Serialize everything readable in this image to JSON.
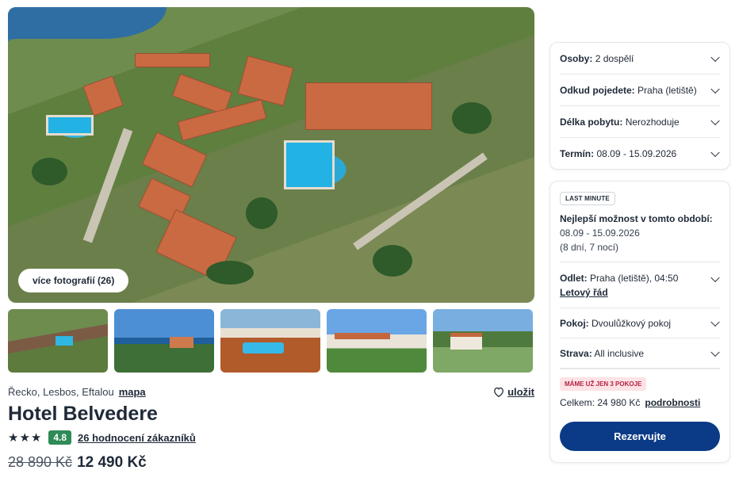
{
  "gallery": {
    "more_photos_label": "více fotografií (26)",
    "thumbnails": [
      "aerial-view",
      "sea-view",
      "pool-terrace",
      "bungalows",
      "garden"
    ]
  },
  "hotel": {
    "location": "Řecko, Lesbos, Eftalou",
    "map_label": "mapa",
    "save_label": "uložit",
    "name": "Hotel Belvedere",
    "stars": "★★★",
    "star_count": 3,
    "score": "4.8",
    "reviews_label": "26 hodnocení zákazníků",
    "old_price": "28 890 Kč",
    "price": "12 490 Kč"
  },
  "search_panel": {
    "persons_label": "Osoby:",
    "persons_value": "2 dospělí",
    "from_label": "Odkud pojedete:",
    "from_value": "Praha (letiště)",
    "length_label": "Délka pobytu:",
    "length_value": "Nerozhoduje",
    "date_label": "Termín:",
    "date_value": "08.09 - 15.09.2026"
  },
  "offer_panel": {
    "badge": "LAST MINUTE",
    "best_heading": "Nejlepší možnost v tomto období:",
    "best_dates": "08.09 - 15.09.2026",
    "best_duration": "(8 dní, 7 nocí)",
    "depart_label": "Odlet:",
    "depart_value": "Praha (letiště), 04:50",
    "schedule_link": "Letový řád",
    "room_label": "Pokoj:",
    "room_value": "Dvoulůžkový pokoj",
    "board_label": "Strava:",
    "board_value": "All inclusive",
    "rooms_badge": "MÁME UŽ JEN 3 POKOJE",
    "total_label": "Celkem: 24 980 Kč",
    "details_link": "podrobnosti",
    "book_button": "Rezervujte"
  },
  "colors": {
    "primary": "#0b3a86",
    "rating": "#2e8b57",
    "alert_bg": "#fde2e6",
    "alert_text": "#b42342"
  }
}
